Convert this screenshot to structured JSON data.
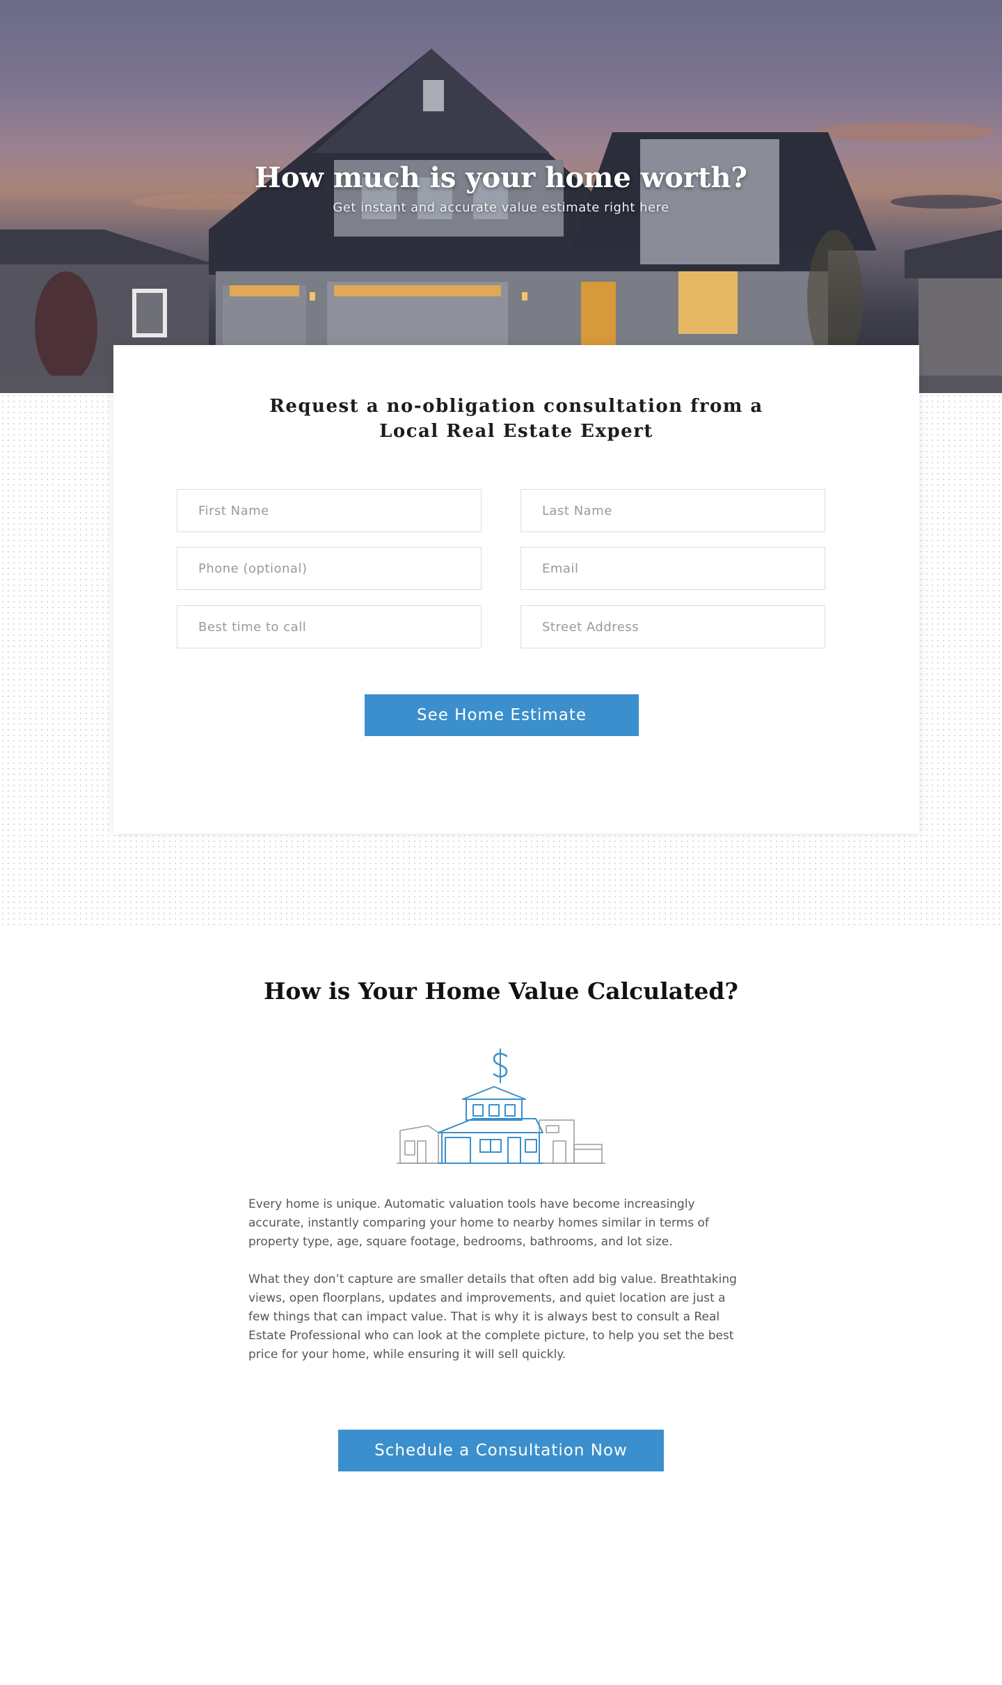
{
  "hero": {
    "title": "How much is your home worth?",
    "subtitle": "Get instant and accurate value estimate right here"
  },
  "form": {
    "heading_line1": "Request a no-obligation consultation from a",
    "heading_line2": "Local Real Estate Expert",
    "first_name_placeholder": "First Name",
    "last_name_placeholder": "Last Name",
    "phone_placeholder": "Phone (optional)",
    "email_placeholder": "Email",
    "best_time_placeholder": "Best time to call",
    "street_address_placeholder": "Street Address",
    "submit_label": "See Home Estimate"
  },
  "info": {
    "heading": "How is Your Home Value Calculated?",
    "paragraph1": "Every home is unique. Automatic valuation tools have become increasingly accurate, instantly comparing your home to nearby homes similar in terms of property type, age, square footage, bedrooms, bathrooms, and lot size.",
    "paragraph2": "What they don’t capture are smaller details that often add big value. Breathtaking views, open floorplans, updates and improvements, and quiet location are just a few things that can impact value. That is why it is always best to consult a Real Estate Professional who can look at the complete picture, to help you set the best price for your home, while ensuring it will sell quickly.",
    "cta_label": "Schedule a Consultation Now",
    "illustration_icon": "house-value-icon"
  },
  "colors": {
    "accent": "#3a8fcc",
    "heading": "#1d1d1d",
    "body_text": "#555555"
  }
}
